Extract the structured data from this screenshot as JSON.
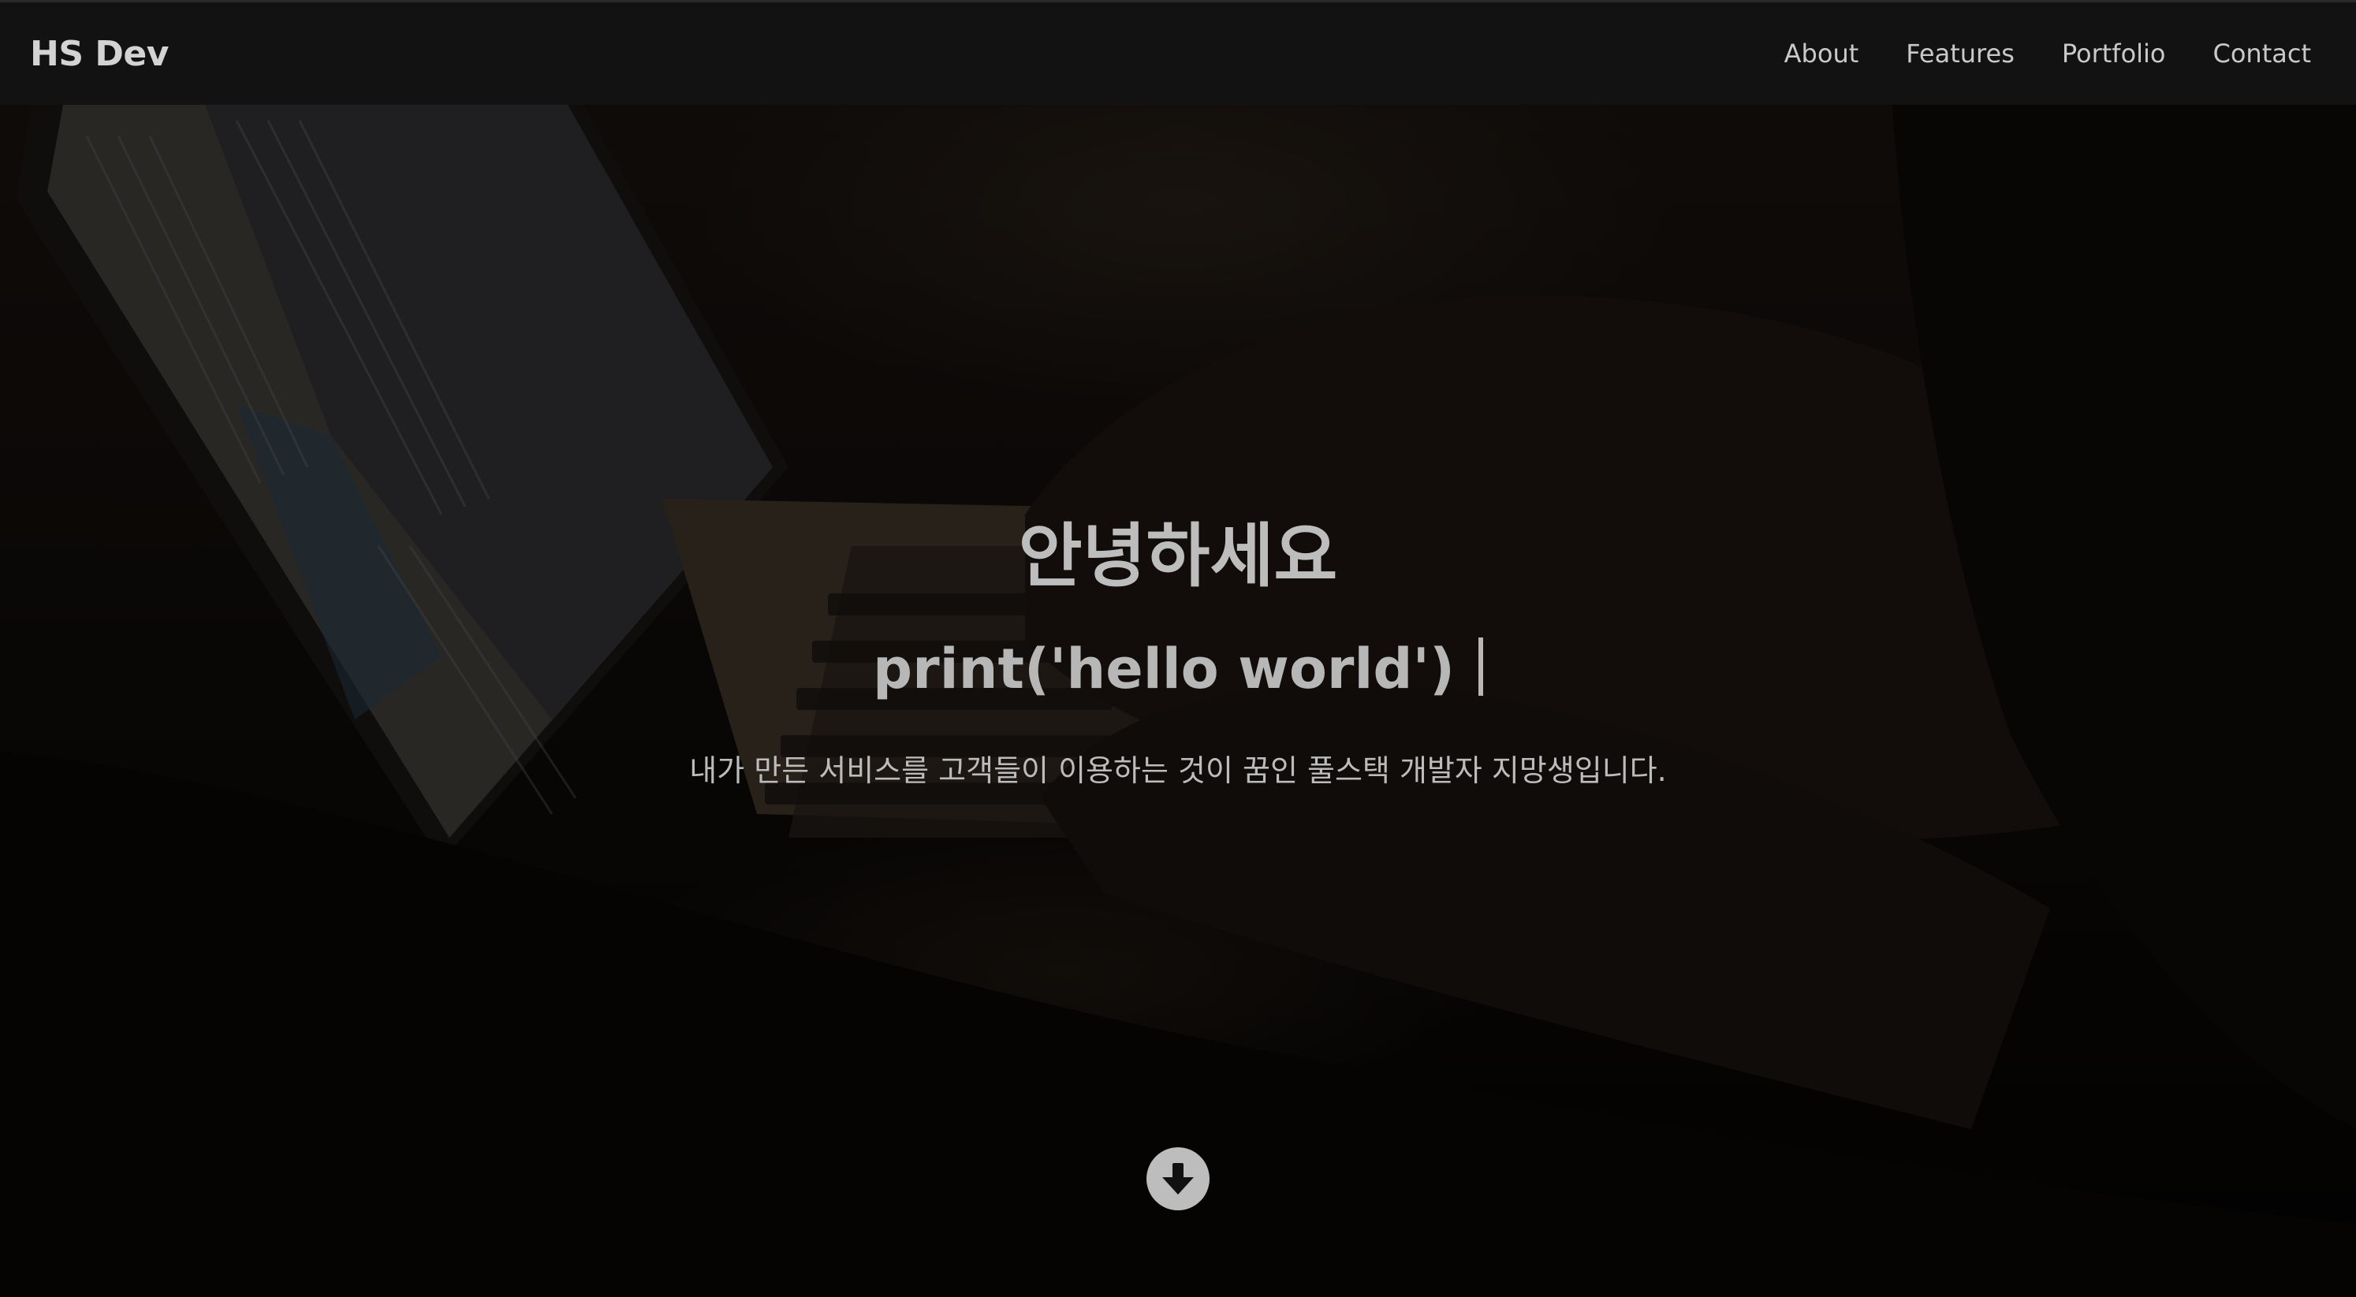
{
  "navbar": {
    "brand": "HS Dev",
    "links": [
      "About",
      "Features",
      "Portfolio",
      "Contact"
    ]
  },
  "hero": {
    "greeting": "안녕하세요",
    "typed_text": "print('hello world')",
    "tagline": "내가 만든 서비스를 고객들이 이용하는 것이 꿈인 풀스택 개발자 지망생입니다.",
    "scroll_icon": "arrow-circle-down-icon"
  },
  "colors": {
    "navbar_bg": "#121212",
    "text": "#bdbdbd"
  }
}
